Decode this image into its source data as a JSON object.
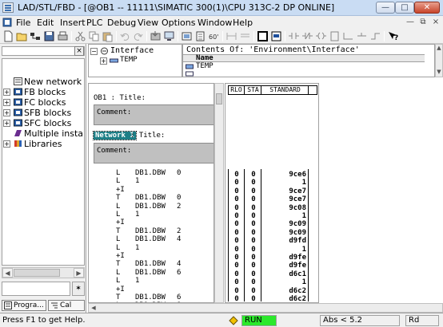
{
  "window": {
    "title": "LAD/STL/FBD  - [@OB1 -- 11111\\SIMATIC 300(1)\\CPU 313C-2 DP  ONLINE]",
    "controls": {
      "minimize": "—",
      "maximize": "□",
      "close": "✕"
    }
  },
  "menu": {
    "items": [
      "File",
      "Edit",
      "Insert",
      "PLC",
      "Debug",
      "View",
      "Options",
      "Window",
      "Help"
    ],
    "doc_controls": [
      "—",
      "⧉",
      "×"
    ]
  },
  "toolbar": {
    "icons": [
      "new-icon",
      "open-icon",
      "network-icon",
      "save-icon",
      "print-icon",
      "cut-icon",
      "copy-icon",
      "paste-icon",
      "undo-icon",
      "redo-icon",
      "load-icon",
      "monitor-icon",
      "stat-icon",
      "block-icon",
      "comment-icon",
      "ladder-icon",
      "stl-icon",
      "fbd-icon",
      "contact-icon",
      "coil-icon",
      "box-icon",
      "branch-icon",
      "help-icon"
    ]
  },
  "left_panel": {
    "tree": [
      {
        "label": "New network",
        "icon": "new-network-icon",
        "expander": ""
      },
      {
        "label": "FB blocks",
        "icon": "fb-blocks-icon",
        "expander": "+"
      },
      {
        "label": "FC blocks",
        "icon": "fc-blocks-icon",
        "expander": "+"
      },
      {
        "label": "SFB blocks",
        "icon": "sfb-blocks-icon",
        "expander": "+"
      },
      {
        "label": "SFC blocks",
        "icon": "sfc-blocks-icon",
        "expander": "+"
      },
      {
        "label": "Multiple instanc",
        "icon": "multiple-instances-icon",
        "expander": ""
      },
      {
        "label": "Libraries",
        "icon": "libraries-icon",
        "expander": "+"
      }
    ],
    "input_button": "✶",
    "tabs": [
      "Progra...",
      "Cal"
    ]
  },
  "interface": {
    "tree": [
      {
        "label": "Interface",
        "expander": "−"
      },
      {
        "label": "TEMP",
        "expander": "+"
      }
    ],
    "contents_label": "Contents Of: 'Environment\\Interface'",
    "name_header": "Name",
    "rows": [
      "TEMP"
    ]
  },
  "program": {
    "block_title": "OB1 : Title:",
    "block_comment": "Comment:",
    "network_label": "Network 1",
    "network_title": ": Title:",
    "network_comment": "Comment:",
    "lines": [
      {
        "op": "L",
        "arg": "DB1.DBW",
        "val": "0"
      },
      {
        "op": "L",
        "arg": "1",
        "val": ""
      },
      {
        "op": "+I",
        "arg": "",
        "val": ""
      },
      {
        "op": "T",
        "arg": "DB1.DBW",
        "val": "0"
      },
      {
        "op": "L",
        "arg": "DB1.DBW",
        "val": "2"
      },
      {
        "op": "L",
        "arg": "1",
        "val": ""
      },
      {
        "op": "+I",
        "arg": "",
        "val": ""
      },
      {
        "op": "T",
        "arg": "DB1.DBW",
        "val": "2"
      },
      {
        "op": "L",
        "arg": "DB1.DBW",
        "val": "4"
      },
      {
        "op": "L",
        "arg": "1",
        "val": ""
      },
      {
        "op": "+I",
        "arg": "",
        "val": ""
      },
      {
        "op": "T",
        "arg": "DB1.DBW",
        "val": "4"
      },
      {
        "op": "L",
        "arg": "DB1.DBW",
        "val": "6"
      },
      {
        "op": "L",
        "arg": "1",
        "val": ""
      },
      {
        "op": "+I",
        "arg": "",
        "val": ""
      },
      {
        "op": "T",
        "arg": "DB1.DBW",
        "val": "6"
      },
      {
        "op": "L",
        "arg": "DB1.DBW",
        "val": "8"
      }
    ]
  },
  "status_columns": {
    "headers": [
      "RLO",
      "STA",
      "STANDARD"
    ],
    "rows": [
      {
        "rlo": "0",
        "sta": "0",
        "std": "9ce6"
      },
      {
        "rlo": "0",
        "sta": "0",
        "std": "1"
      },
      {
        "rlo": "0",
        "sta": "0",
        "std": "9ce7"
      },
      {
        "rlo": "0",
        "sta": "0",
        "std": "9ce7"
      },
      {
        "rlo": "0",
        "sta": "0",
        "std": "9c08"
      },
      {
        "rlo": "0",
        "sta": "0",
        "std": "1"
      },
      {
        "rlo": "0",
        "sta": "0",
        "std": "9c09"
      },
      {
        "rlo": "0",
        "sta": "0",
        "std": "9c09"
      },
      {
        "rlo": "0",
        "sta": "0",
        "std": "d9fd"
      },
      {
        "rlo": "0",
        "sta": "0",
        "std": "1"
      },
      {
        "rlo": "0",
        "sta": "0",
        "std": "d9fe"
      },
      {
        "rlo": "0",
        "sta": "0",
        "std": "d9fe"
      },
      {
        "rlo": "0",
        "sta": "0",
        "std": "d6c1"
      },
      {
        "rlo": "0",
        "sta": "0",
        "std": "1"
      },
      {
        "rlo": "0",
        "sta": "0",
        "std": "d6c2"
      },
      {
        "rlo": "0",
        "sta": "0",
        "std": "d6c2"
      }
    ]
  },
  "status_bar": {
    "help": "Press F1 to get Help.",
    "mode": "RUN",
    "abs": "Abs < 5.2",
    "rd": "Rd",
    "colors": {
      "run": "#2ce82c"
    }
  }
}
